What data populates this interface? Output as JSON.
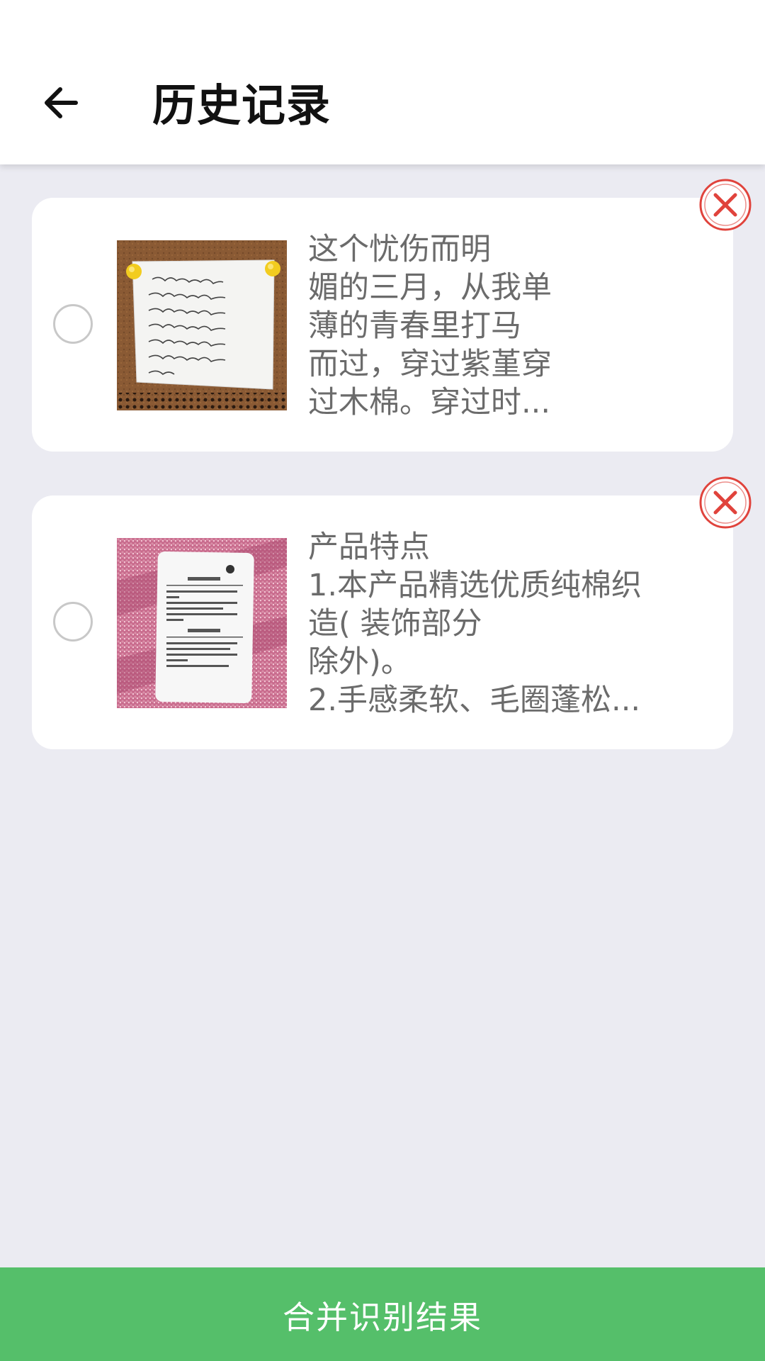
{
  "header": {
    "title": "历史记录",
    "back_icon": "arrow-left-icon"
  },
  "records": [
    {
      "text": "这个忧伤而明\n媚的三月，从我单\n薄的青春里打马\n而过，穿过紫堇穿\n过木棉。穿过时...",
      "thumbnail_icon": "handwritten-note-photo",
      "delete_icon": "close-circle-icon"
    },
    {
      "text": "产品特点\n1.本产品精选优质纯棉织\n造( 装饰部分\n除外)。\n2.手感柔软、毛圈蓬松...",
      "thumbnail_icon": "product-tag-photo",
      "delete_icon": "close-circle-icon"
    }
  ],
  "footer": {
    "merge_label": "合并识别结果"
  },
  "colors": {
    "accent": "#55bf6a",
    "delete_red": "#e0433c",
    "background": "#ebebf2"
  }
}
